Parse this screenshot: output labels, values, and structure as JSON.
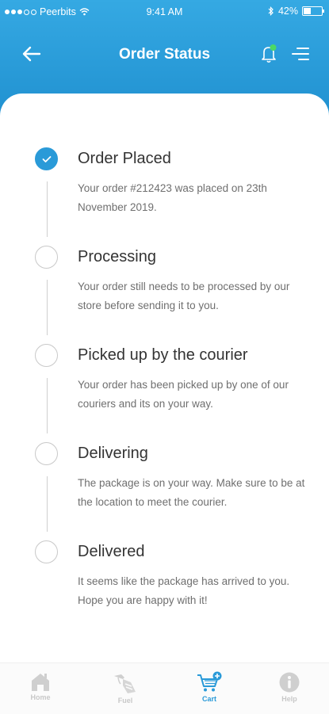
{
  "status_bar": {
    "carrier": "Peerbits",
    "time": "9:41 AM",
    "battery_percent": "42%",
    "battery_level": 0.42
  },
  "nav": {
    "title": "Order Status",
    "back_icon": "arrow-left-icon",
    "notification_icon": "bell-icon",
    "menu_icon": "menu-icon",
    "notification_dot_color": "#4cd964"
  },
  "colors": {
    "primary": "#2a9ad8",
    "header_top": "#35a9e3",
    "header_bottom": "#1f8fcf"
  },
  "steps": [
    {
      "title": "Order Placed",
      "description": "Your order #212423 was placed on 23th November 2019.",
      "completed": true
    },
    {
      "title": "Processing",
      "description": "Your order still needs to be processed by our store before sending it to you.",
      "completed": false
    },
    {
      "title": "Picked up by the courier",
      "description": "Your order has been picked up by one of our couriers and its on your way.",
      "completed": false
    },
    {
      "title": "Delivering",
      "description": "The package is on your way. Make sure to be at the location to meet the courier.",
      "completed": false
    },
    {
      "title": "Delivered",
      "description": "It seems like the package has arrived to you. Hope you are happy with it!",
      "completed": false
    }
  ],
  "tabbar": {
    "tabs": [
      {
        "label": "Home",
        "icon": "home-icon",
        "active": false
      },
      {
        "label": "Fuel",
        "icon": "fuel-icon",
        "active": false
      },
      {
        "label": "Cart",
        "icon": "cart-icon",
        "active": true
      },
      {
        "label": "Help",
        "icon": "help-icon",
        "active": false
      }
    ]
  }
}
